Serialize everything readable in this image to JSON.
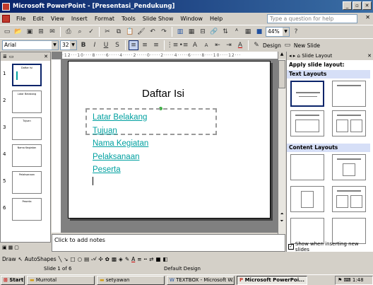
{
  "window": {
    "title": "Microsoft PowerPoint - [Presentasi_Pendukung]"
  },
  "menu": [
    "File",
    "Edit",
    "View",
    "Insert",
    "Format",
    "Tools",
    "Slide Show",
    "Window",
    "Help"
  ],
  "help_placeholder": "Type a question for help",
  "toolbar": {
    "zoom": "44%",
    "font": "Arial",
    "size": "32",
    "design": "Design",
    "new_slide": "New Slide"
  },
  "thumbnails": [
    {
      "num": "1",
      "title": "Daftar Isi"
    },
    {
      "num": "2",
      "title": "Latar Belakang"
    },
    {
      "num": "3",
      "title": "Tujuan"
    },
    {
      "num": "4",
      "title": "Nama Kegiatan"
    },
    {
      "num": "5",
      "title": "Pelaksanaan"
    },
    {
      "num": "6",
      "title": "Peserta"
    }
  ],
  "slide": {
    "title": "Daftar Isi",
    "bullets": [
      "Latar Belakang",
      "Tujuan",
      "Nama Kegiatan",
      "Pelaksanaan",
      "Peserta"
    ]
  },
  "notes_placeholder": "Click to add notes",
  "taskpane": {
    "title": "Slide Layout",
    "apply_label": "Apply slide layout:",
    "text_layouts": "Text Layouts",
    "content_layouts": "Content Layouts",
    "show_checkbox": "Show when inserting new slides"
  },
  "drawbar": {
    "draw": "Draw",
    "autoshapes": "AutoShapes"
  },
  "status": {
    "slide": "Slide 1 of 6",
    "design": "Default Design"
  },
  "taskbar": {
    "start": "Start",
    "items": [
      "Murrotal",
      "setyawan",
      "TEXTBOX - Microsoft W...",
      "Microsoft PowerPoi..."
    ],
    "clock": "1:48"
  }
}
